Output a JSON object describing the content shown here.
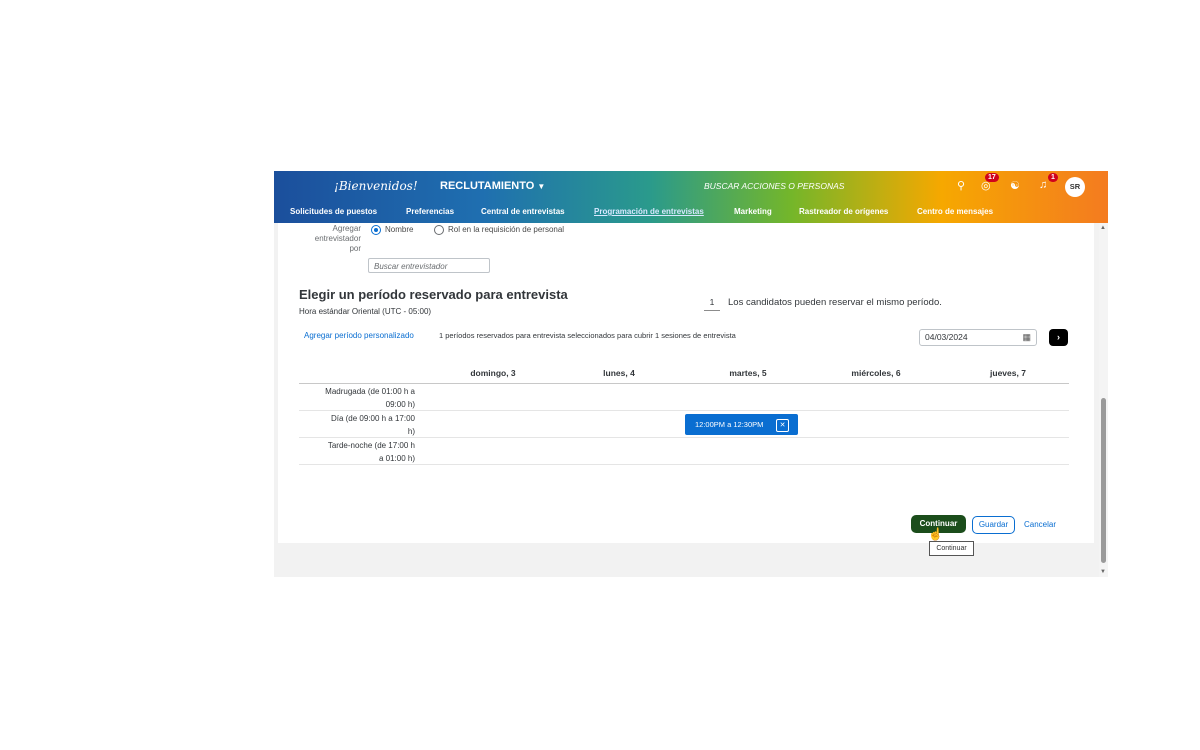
{
  "header": {
    "logo_text": "¡Bienvenidos!",
    "module": "RECLUTAMIENTO",
    "search_placeholder": "BUSCAR ACCIONES O PERSONAS",
    "tasks_count": "17",
    "notifications_count": "1",
    "avatar_initials": "SR"
  },
  "nav": {
    "items": [
      "Solicitudes de puestos",
      "Preferencias",
      "Central de entrevistas",
      "Programación de entrevistas",
      "Marketing",
      "Rastreador de orígenes",
      "Centro de mensajes"
    ],
    "active": "Programación de entrevistas"
  },
  "form": {
    "add_by_label": "Agregar entrevistador por",
    "option_name": "Nombre",
    "option_role": "Rol en la requisición de personal",
    "search_placeholder": "Buscar entrevistador"
  },
  "section": {
    "title": "Elegir un período reservado para entrevista",
    "timezone": "Hora estándar Oriental (UTC - 05:00)",
    "same_slot_count": "1",
    "same_slot_text": "Los candidatos pueden reservar el mismo período.",
    "add_custom_link": "Agregar período personalizado",
    "summary": "1 períodos reservados para entrevista seleccionados para cubrir 1 sesiones de entrevista",
    "date": "04/03/2024"
  },
  "calendar": {
    "days": [
      "domingo, 3",
      "lunes, 4",
      "martes, 5",
      "miércoles, 6",
      "jueves, 7"
    ],
    "slots": [
      {
        "line1": "Madrugada (de 01:00 h a",
        "line2": "09:00 h)"
      },
      {
        "line1": "Día (de 09:00 h a 17:00",
        "line2": "h)"
      },
      {
        "line1": "Tarde-noche (de 17:00 h",
        "line2": "a 01:00 h)"
      }
    ],
    "booked": "12:00PM a 12:30PM"
  },
  "actions": {
    "continue": "Continuar",
    "save": "Guardar",
    "cancel": "Cancelar",
    "tooltip": "Continuar"
  },
  "colors": {
    "primary_blue": "#0a6ed1",
    "continue_green": "#1b4d1b"
  }
}
